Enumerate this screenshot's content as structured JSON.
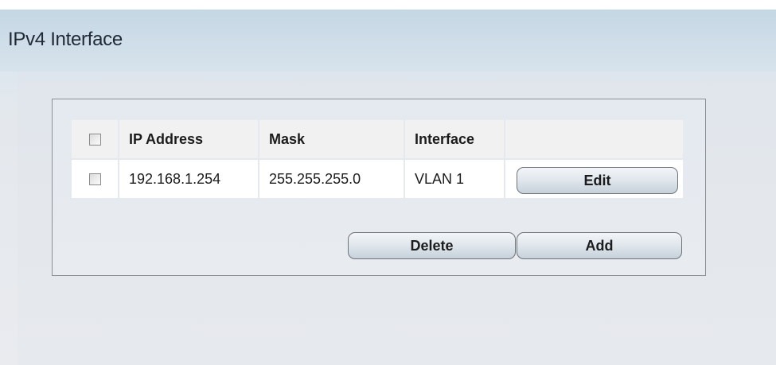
{
  "page": {
    "title": "IPv4 Interface"
  },
  "table": {
    "columns": [
      "IP Address",
      "Mask",
      "Interface"
    ],
    "rows": [
      {
        "ip": "192.168.1.254",
        "mask": "255.255.255.0",
        "interface": "VLAN 1",
        "action": "Edit",
        "checked": false
      }
    ],
    "select_all_checked": false
  },
  "buttons": {
    "delete": "Delete",
    "add": "Add"
  },
  "colors": {
    "header_bg": "#c9dae6",
    "panel_border": "#8c8f94",
    "table_header_bg": "#f1f1f1"
  }
}
